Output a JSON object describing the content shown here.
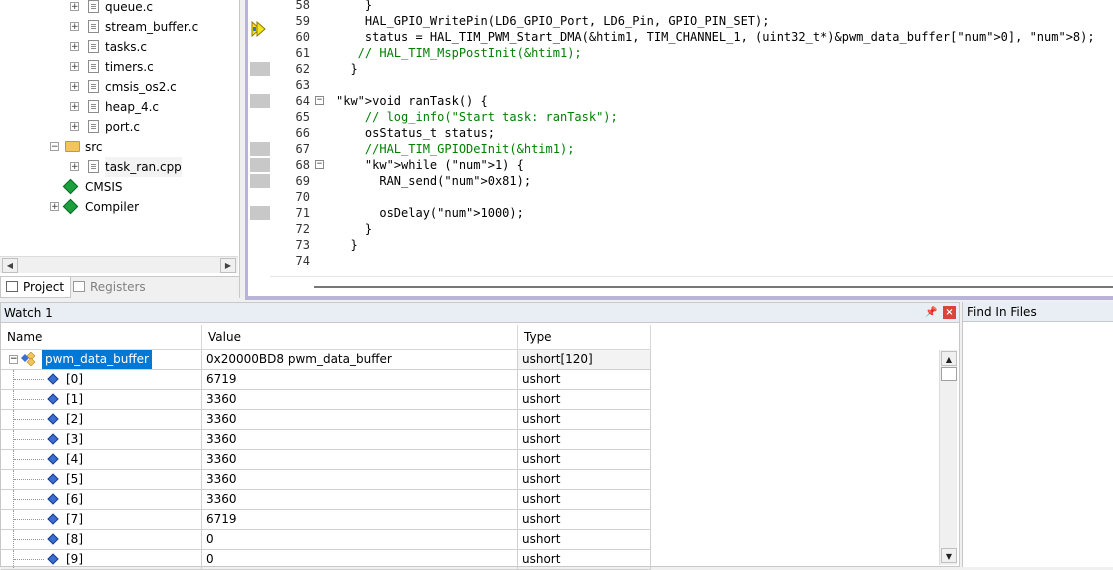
{
  "project": {
    "tree": [
      {
        "label": "queue.c",
        "kind": "file",
        "expand": "+"
      },
      {
        "label": "stream_buffer.c",
        "kind": "file",
        "expand": "+"
      },
      {
        "label": "tasks.c",
        "kind": "file",
        "expand": "+"
      },
      {
        "label": "timers.c",
        "kind": "file",
        "expand": "+"
      },
      {
        "label": "cmsis_os2.c",
        "kind": "file",
        "expand": "+"
      },
      {
        "label": "heap_4.c",
        "kind": "file",
        "expand": "+"
      },
      {
        "label": "port.c",
        "kind": "file",
        "expand": "+"
      },
      {
        "label": "src",
        "kind": "folder",
        "expand": "−"
      },
      {
        "label": "task_ran.cpp",
        "kind": "file",
        "expand": "+"
      },
      {
        "label": "CMSIS",
        "kind": "component",
        "expand": ""
      },
      {
        "label": "Compiler",
        "kind": "component",
        "expand": "+"
      }
    ],
    "tabs": {
      "project": "Project",
      "registers": "Registers"
    }
  },
  "editor": {
    "lines": [
      {
        "no": "58",
        "text": "    }",
        "bp": false
      },
      {
        "no": "59",
        "text": "    HAL_GPIO_WritePin(LD6_GPIO_Port, LD6_Pin, GPIO_PIN_SET);",
        "bp": false
      },
      {
        "no": "60",
        "text": "    status = HAL_TIM_PWM_Start_DMA(&htim1, TIM_CHANNEL_1, (uint32_t*)&pwm_data_buffer[0], 8);",
        "bp": false
      },
      {
        "no": "61",
        "text": "   // HAL_TIM_MspPostInit(&htim1);",
        "bp": false,
        "comment": true
      },
      {
        "no": "62",
        "text": "  }",
        "bp": true
      },
      {
        "no": "63",
        "text": "",
        "bp": false
      },
      {
        "no": "64",
        "text": "void ranTask() {",
        "bp": true,
        "fold": "−"
      },
      {
        "no": "65",
        "text": "    // log_info(\"Start task: ranTask\");",
        "bp": false,
        "comment": true
      },
      {
        "no": "66",
        "text": "    osStatus_t status;",
        "bp": false
      },
      {
        "no": "67",
        "text": "    //HAL_TIM_GPIODeInit(&htim1);",
        "bp": true,
        "comment": true
      },
      {
        "no": "68",
        "text": "    while (1) {",
        "bp": true,
        "fold": "−"
      },
      {
        "no": "69",
        "text": "      RAN_send(0x81);",
        "bp": true
      },
      {
        "no": "70",
        "text": "",
        "bp": false
      },
      {
        "no": "71",
        "text": "      osDelay(1000);",
        "bp": true
      },
      {
        "no": "72",
        "text": "    }",
        "bp": false
      },
      {
        "no": "73",
        "text": "  }",
        "bp": false
      },
      {
        "no": "74",
        "text": "",
        "bp": false
      }
    ]
  },
  "watch": {
    "title": "Watch 1",
    "pin_icon": "pin-icon",
    "close_icon": "close-icon",
    "columns": {
      "name": "Name",
      "value": "Value",
      "type": "Type"
    },
    "root": {
      "name": "pwm_data_buffer",
      "value": "0x20000BD8 pwm_data_buffer",
      "type": "ushort[120]",
      "expand": "−"
    },
    "items": [
      {
        "name": "[0]",
        "value": "6719",
        "type": "ushort"
      },
      {
        "name": "[1]",
        "value": "3360",
        "type": "ushort"
      },
      {
        "name": "[2]",
        "value": "3360",
        "type": "ushort"
      },
      {
        "name": "[3]",
        "value": "3360",
        "type": "ushort"
      },
      {
        "name": "[4]",
        "value": "3360",
        "type": "ushort"
      },
      {
        "name": "[5]",
        "value": "3360",
        "type": "ushort"
      },
      {
        "name": "[6]",
        "value": "3360",
        "type": "ushort"
      },
      {
        "name": "[7]",
        "value": "6719",
        "type": "ushort"
      },
      {
        "name": "[8]",
        "value": "0",
        "type": "ushort"
      },
      {
        "name": "[9]",
        "value": "0",
        "type": "ushort"
      }
    ]
  },
  "find": {
    "title": "Find In Files"
  },
  "colors": {
    "accent": "#0078d7",
    "comment": "#008000",
    "keyword": "#0000ff",
    "number": "#8b008b",
    "editor_border": "#b9b3d6"
  }
}
